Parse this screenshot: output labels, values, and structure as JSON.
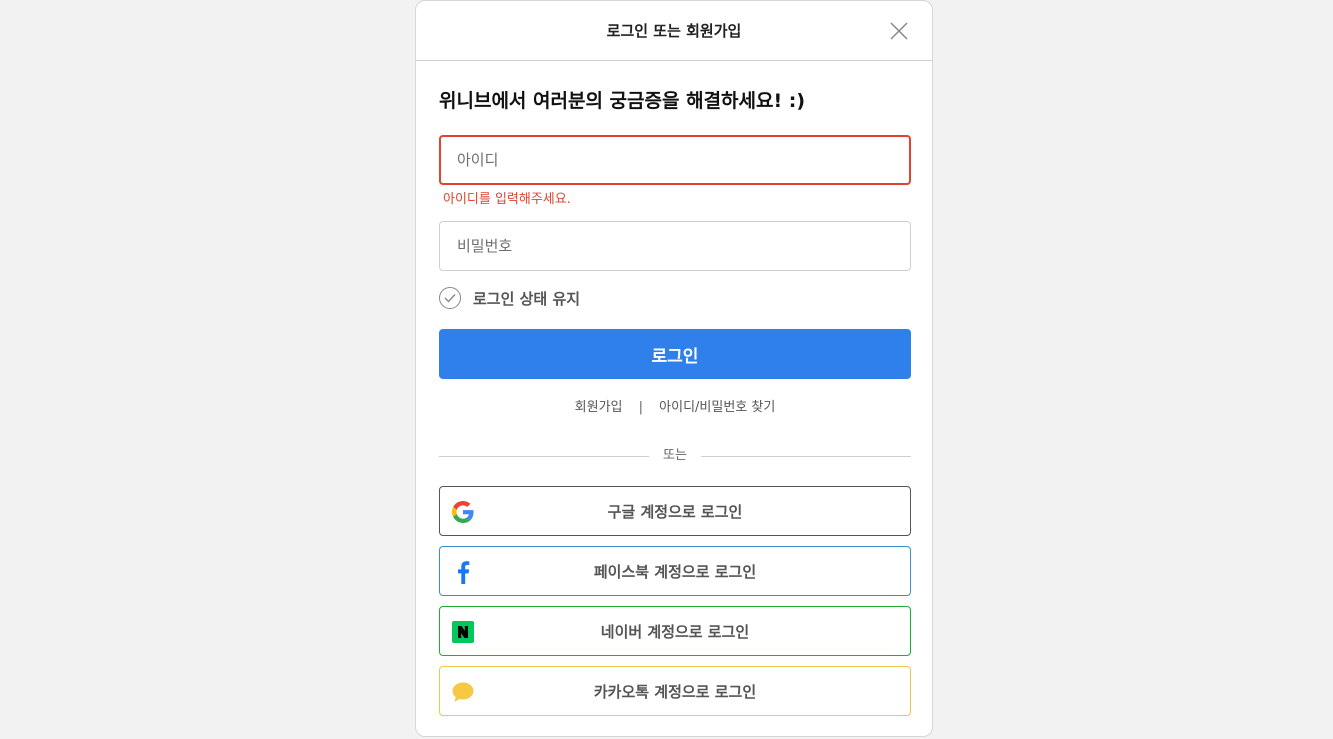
{
  "modal": {
    "title": "로그인 또는 회원가입",
    "headline": "위니브에서 여러분의 궁금증을 해결하세요! :)"
  },
  "form": {
    "id_placeholder": "아이디",
    "id_value": "",
    "id_error": "아이디를 입력해주세요.",
    "password_placeholder": "비밀번호",
    "password_value": "",
    "keep_login_label": "로그인 상태 유지",
    "keep_login_checked": false,
    "login_button": "로그인"
  },
  "links": {
    "signup": "회원가입",
    "separator": "|",
    "find": "아이디/비밀번호 찾기"
  },
  "divider_text": "또는",
  "social": [
    {
      "label": "구글 계정으로 로그인",
      "icon": "google-icon"
    },
    {
      "label": "페이스북 계정으로 로그인",
      "icon": "facebook-icon"
    },
    {
      "label": "네이버 계정으로 로그인",
      "icon": "naver-icon"
    },
    {
      "label": "카카오톡 계정으로 로그인",
      "icon": "kakao-icon"
    }
  ],
  "colors": {
    "primary": "#2f80ea",
    "error": "#e2432f",
    "facebook": "#1877f2",
    "naver": "#03c75a",
    "kakao": "#f7d04a"
  }
}
